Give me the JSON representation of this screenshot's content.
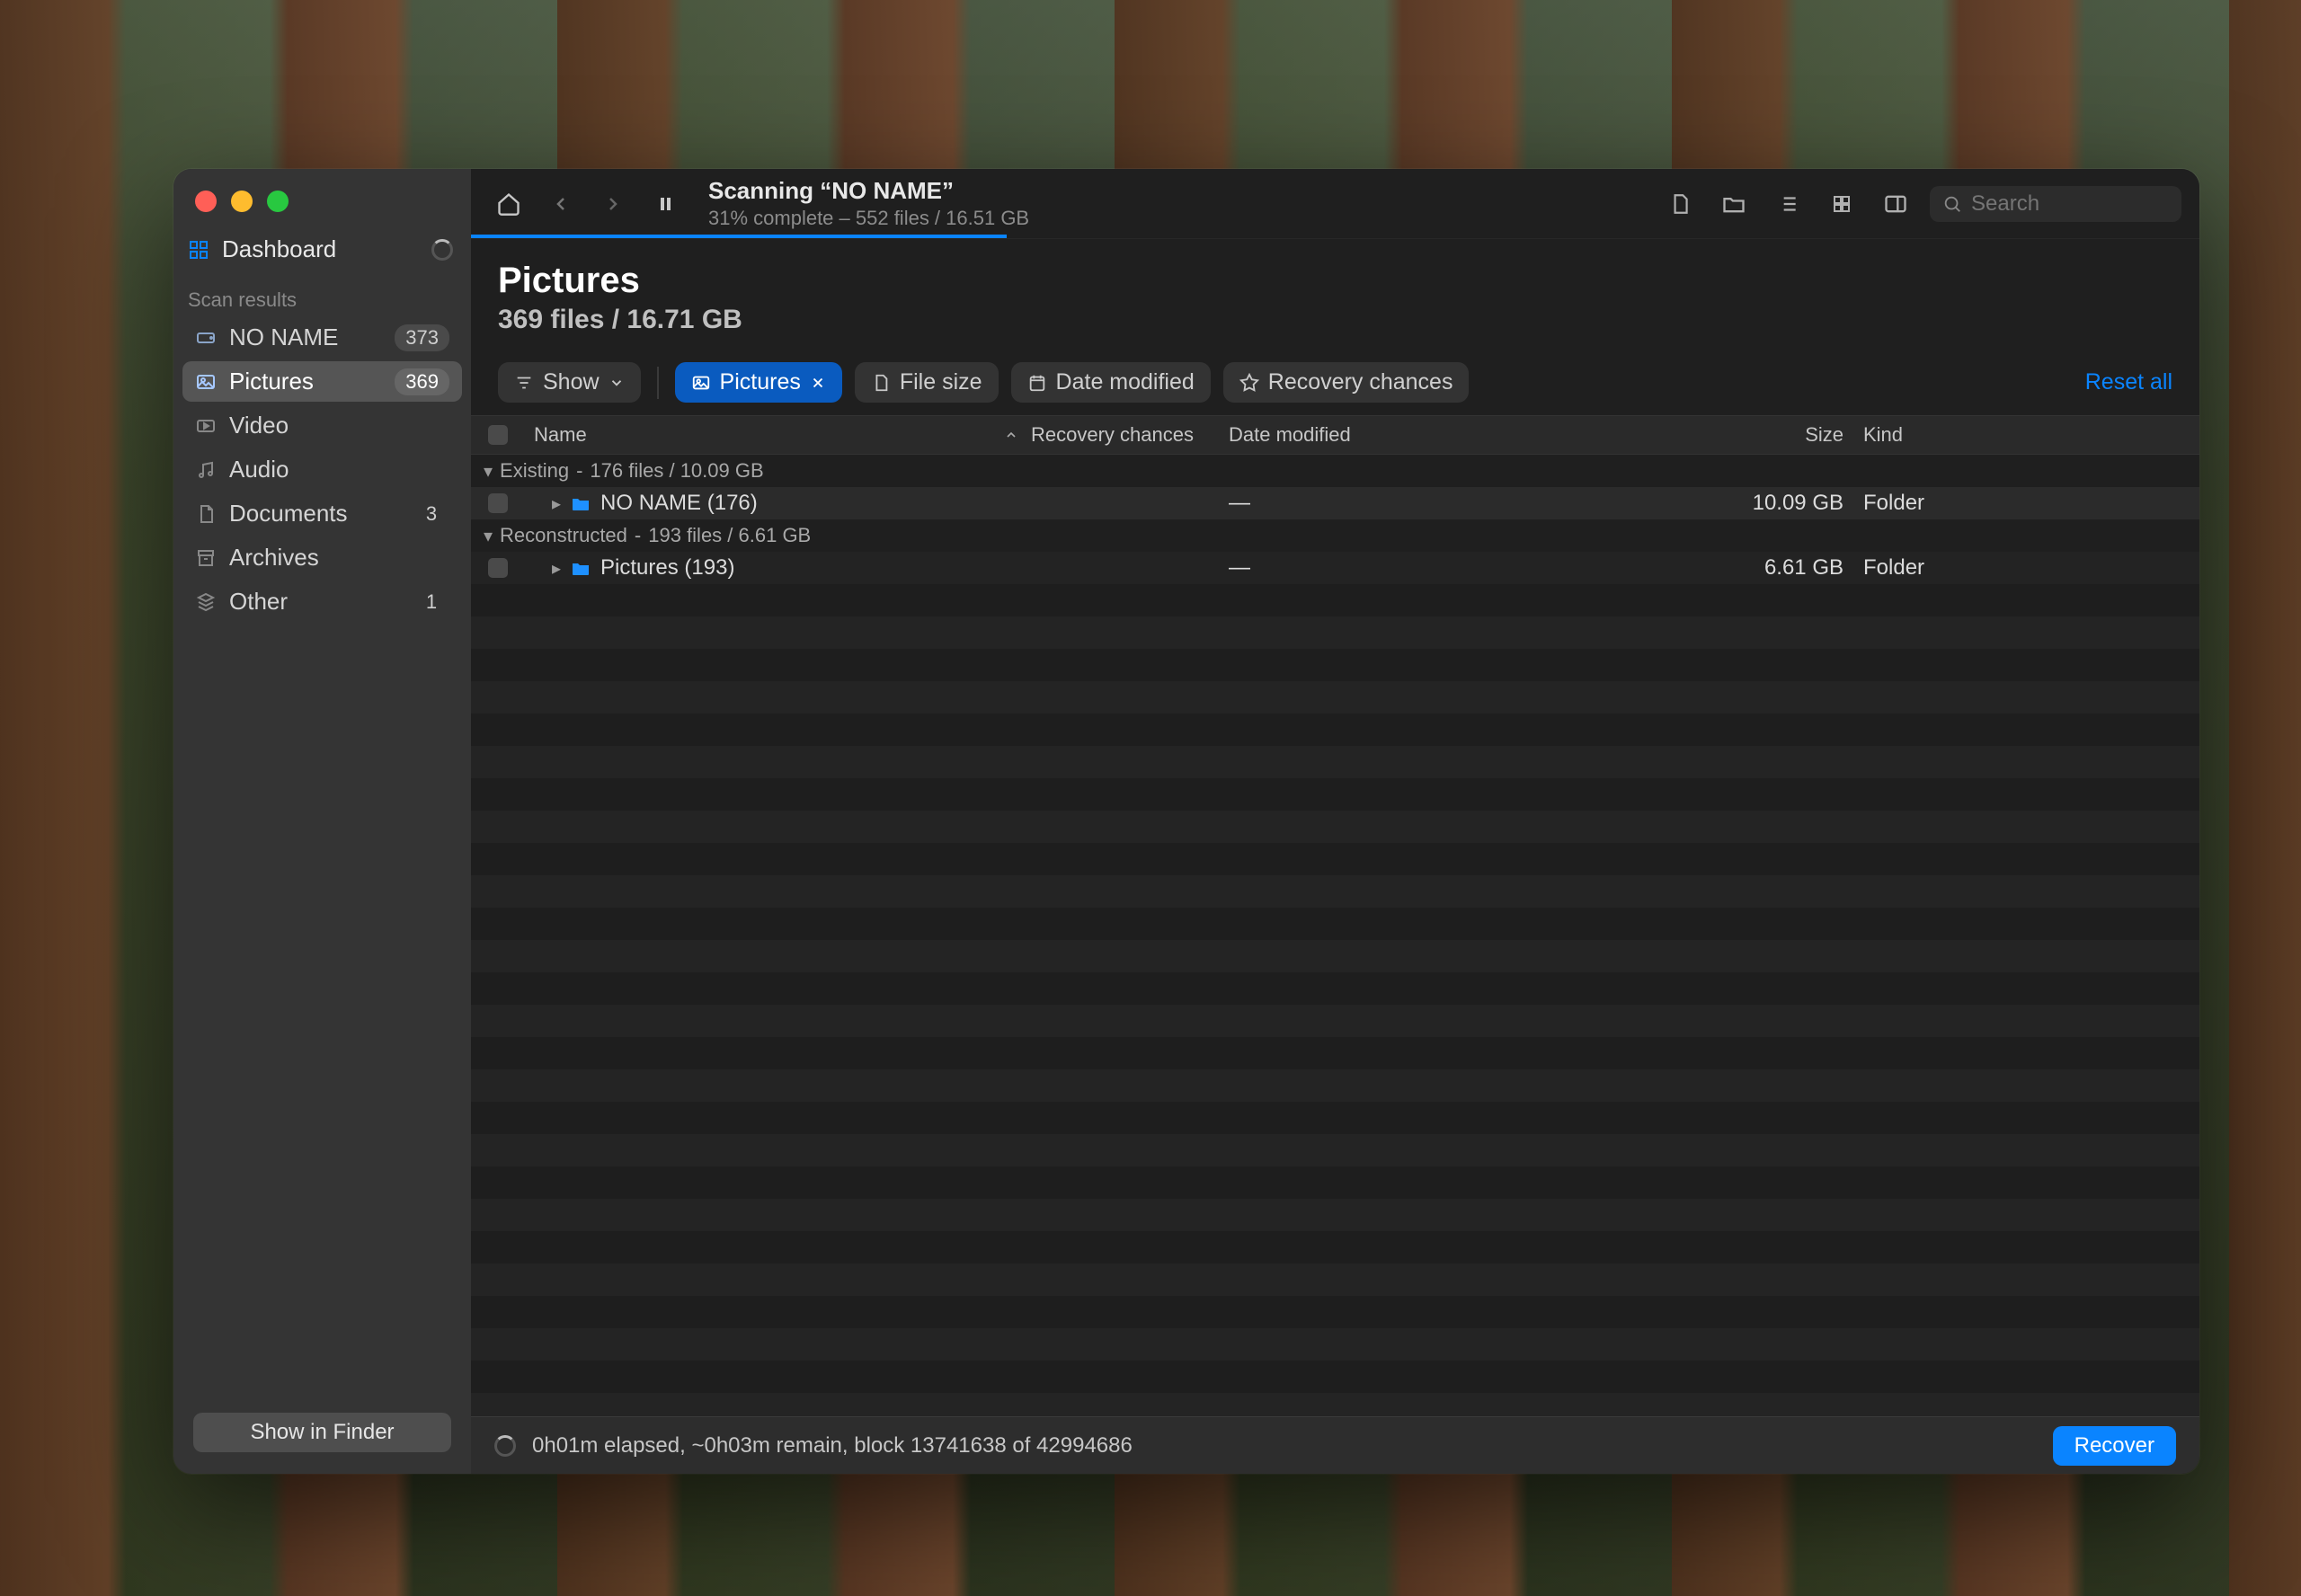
{
  "sidebar": {
    "dashboard_label": "Dashboard",
    "section_label": "Scan results",
    "items": [
      {
        "label": "NO NAME",
        "badge": "373",
        "icon": "disk"
      },
      {
        "label": "Pictures",
        "badge": "369",
        "icon": "image",
        "active": true
      },
      {
        "label": "Video",
        "badge": "",
        "icon": "video"
      },
      {
        "label": "Audio",
        "badge": "",
        "icon": "audio"
      },
      {
        "label": "Documents",
        "badge": "3",
        "icon": "document"
      },
      {
        "label": "Archives",
        "badge": "",
        "icon": "archive"
      },
      {
        "label": "Other",
        "badge": "1",
        "icon": "other"
      }
    ],
    "show_in_finder": "Show in Finder"
  },
  "toolbar": {
    "scan_title": "Scanning “NO NAME”",
    "scan_sub": "31% complete – 552 files / 16.51 GB",
    "progress_percent": 31,
    "search_placeholder": "Search"
  },
  "header": {
    "title": "Pictures",
    "subtitle": "369 files / 16.71 GB"
  },
  "filters": {
    "show_label": "Show",
    "active_filter": "Pictures",
    "file_size": "File size",
    "date_modified": "Date modified",
    "recovery_chances": "Recovery chances",
    "reset_all": "Reset all"
  },
  "columns": {
    "name": "Name",
    "recovery": "Recovery chances",
    "date": "Date modified",
    "size": "Size",
    "kind": "Kind"
  },
  "groups": [
    {
      "label": "Existing",
      "meta": "176 files / 10.09 GB",
      "rows": [
        {
          "name": "NO NAME (176)",
          "date": "—",
          "size": "10.09 GB",
          "kind": "Folder"
        }
      ]
    },
    {
      "label": "Reconstructed",
      "meta": "193 files / 6.61 GB",
      "rows": [
        {
          "name": "Pictures (193)",
          "date": "—",
          "size": "6.61 GB",
          "kind": "Folder"
        }
      ]
    }
  ],
  "status": {
    "text": "0h01m elapsed, ~0h03m remain, block 13741638 of 42994686",
    "recover": "Recover"
  }
}
